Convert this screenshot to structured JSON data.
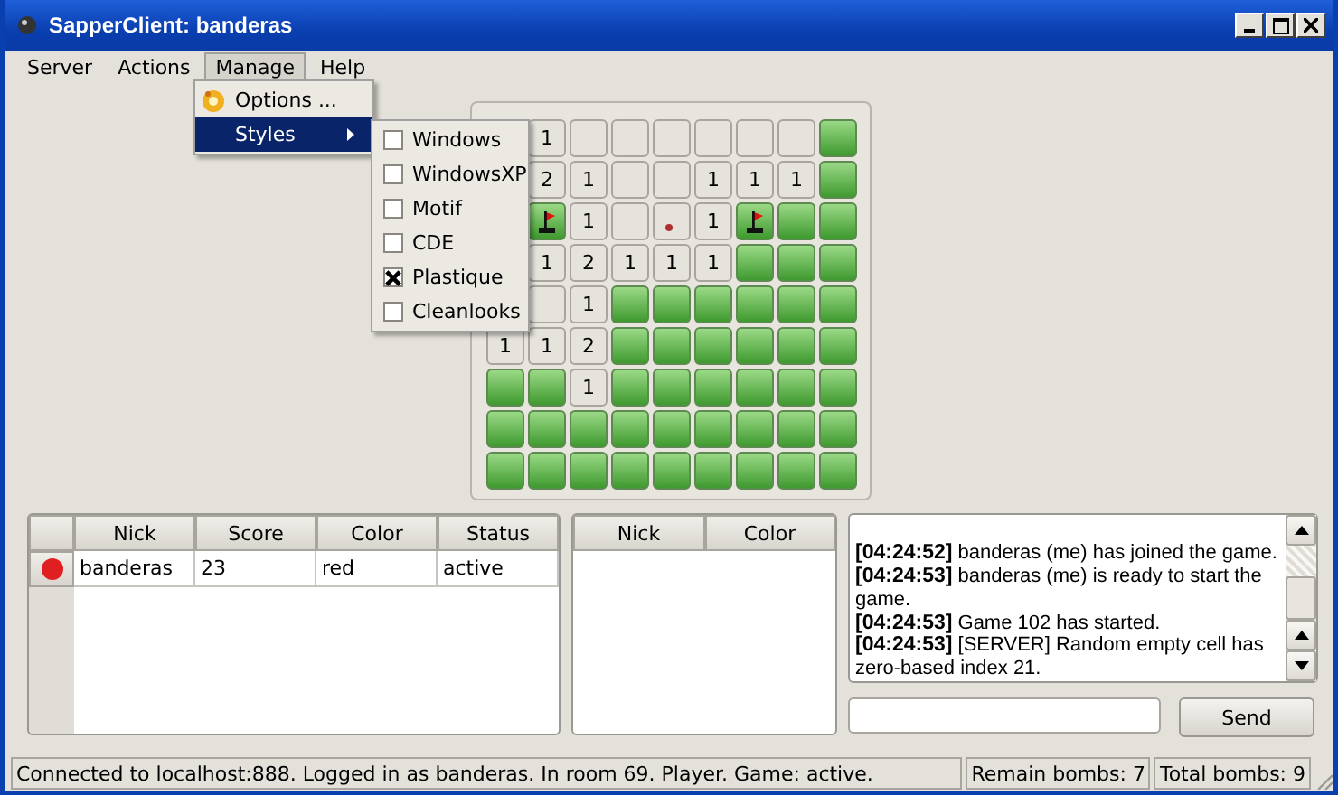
{
  "window": {
    "title": "SapperClient: banderas"
  },
  "menu_bar": [
    {
      "label": "Server",
      "selected": false
    },
    {
      "label": "Actions",
      "selected": false
    },
    {
      "label": "Manage",
      "selected": true
    },
    {
      "label": "Help",
      "selected": false
    }
  ],
  "manage_menu": [
    {
      "label": "Options ...",
      "kind": "action",
      "selected": false
    },
    {
      "label": "Styles",
      "kind": "submenu",
      "selected": true
    }
  ],
  "styles_menu": [
    {
      "label": "Windows",
      "checked": false
    },
    {
      "label": "WindowsXP",
      "checked": false
    },
    {
      "label": "Motif",
      "checked": false
    },
    {
      "label": "CDE",
      "checked": false
    },
    {
      "label": "Plastique",
      "checked": true
    },
    {
      "label": "Cleanlooks",
      "checked": false
    }
  ],
  "board": {
    "rows": [
      [
        {
          "kind": "hidden"
        },
        {
          "kind": "open",
          "text": "1"
        },
        {
          "kind": "open"
        },
        {
          "kind": "open"
        },
        {
          "kind": "open"
        },
        {
          "kind": "open"
        },
        {
          "kind": "open"
        },
        {
          "kind": "open"
        },
        {
          "kind": "closed"
        }
      ],
      [
        {
          "kind": "hidden"
        },
        {
          "kind": "open",
          "text": "2"
        },
        {
          "kind": "open",
          "text": "1"
        },
        {
          "kind": "open"
        },
        {
          "kind": "open"
        },
        {
          "kind": "open",
          "text": "1"
        },
        {
          "kind": "open",
          "text": "1"
        },
        {
          "kind": "open",
          "text": "1"
        },
        {
          "kind": "closed"
        }
      ],
      [
        {
          "kind": "hidden"
        },
        {
          "kind": "flag"
        },
        {
          "kind": "open",
          "text": "1"
        },
        {
          "kind": "open"
        },
        {
          "kind": "marked"
        },
        {
          "kind": "open",
          "text": "1"
        },
        {
          "kind": "flag"
        },
        {
          "kind": "closed"
        },
        {
          "kind": "closed"
        }
      ],
      [
        {
          "kind": "hidden"
        },
        {
          "kind": "open",
          "text": "1"
        },
        {
          "kind": "open",
          "text": "2"
        },
        {
          "kind": "open",
          "text": "1"
        },
        {
          "kind": "open",
          "text": "1"
        },
        {
          "kind": "open",
          "text": "1"
        },
        {
          "kind": "closed"
        },
        {
          "kind": "closed"
        },
        {
          "kind": "closed"
        }
      ],
      [
        {
          "kind": "hidden"
        },
        {
          "kind": "open"
        },
        {
          "kind": "open",
          "text": "1"
        },
        {
          "kind": "closed"
        },
        {
          "kind": "closed"
        },
        {
          "kind": "closed"
        },
        {
          "kind": "closed"
        },
        {
          "kind": "closed"
        },
        {
          "kind": "closed"
        }
      ],
      [
        {
          "kind": "open",
          "text": "1"
        },
        {
          "kind": "open",
          "text": "1"
        },
        {
          "kind": "open",
          "text": "2"
        },
        {
          "kind": "closed"
        },
        {
          "kind": "closed"
        },
        {
          "kind": "closed"
        },
        {
          "kind": "closed"
        },
        {
          "kind": "closed"
        },
        {
          "kind": "closed"
        }
      ],
      [
        {
          "kind": "closed"
        },
        {
          "kind": "closed"
        },
        {
          "kind": "open",
          "text": "1"
        },
        {
          "kind": "closed"
        },
        {
          "kind": "closed"
        },
        {
          "kind": "closed"
        },
        {
          "kind": "closed"
        },
        {
          "kind": "closed"
        },
        {
          "kind": "closed"
        }
      ],
      [
        {
          "kind": "closed"
        },
        {
          "kind": "closed"
        },
        {
          "kind": "closed"
        },
        {
          "kind": "closed"
        },
        {
          "kind": "closed"
        },
        {
          "kind": "closed"
        },
        {
          "kind": "closed"
        },
        {
          "kind": "closed"
        },
        {
          "kind": "closed"
        }
      ],
      [
        {
          "kind": "closed"
        },
        {
          "kind": "closed"
        },
        {
          "kind": "closed"
        },
        {
          "kind": "closed"
        },
        {
          "kind": "closed"
        },
        {
          "kind": "closed"
        },
        {
          "kind": "closed"
        },
        {
          "kind": "closed"
        },
        {
          "kind": "closed"
        }
      ]
    ]
  },
  "players_table": {
    "columns": [
      "Nick",
      "Score",
      "Color",
      "Status"
    ],
    "rows": [
      {
        "color": "#e02020",
        "cells": [
          "banderas",
          "23",
          "red",
          "active"
        ]
      }
    ]
  },
  "spectators_table": {
    "columns": [
      "Nick",
      "Color"
    ]
  },
  "log": [
    {
      "time": "[04:24:52]",
      "text": "banderas (me) has joined the game."
    },
    {
      "time": "[04:24:53]",
      "text": "banderas (me) is ready to start the game."
    },
    {
      "time": "[04:24:53]",
      "text": "Game 102 has started."
    },
    {
      "time": "[04:24:53]",
      "text": "[SERVER] Random empty cell has zero-based index 21."
    }
  ],
  "send_button": "Send",
  "status_bar": {
    "message": "Connected to localhost:888. Logged in as banderas. In room 69. Player. Game: active.",
    "remain": "Remain bombs: 7",
    "total": "Total bombs: 9"
  }
}
